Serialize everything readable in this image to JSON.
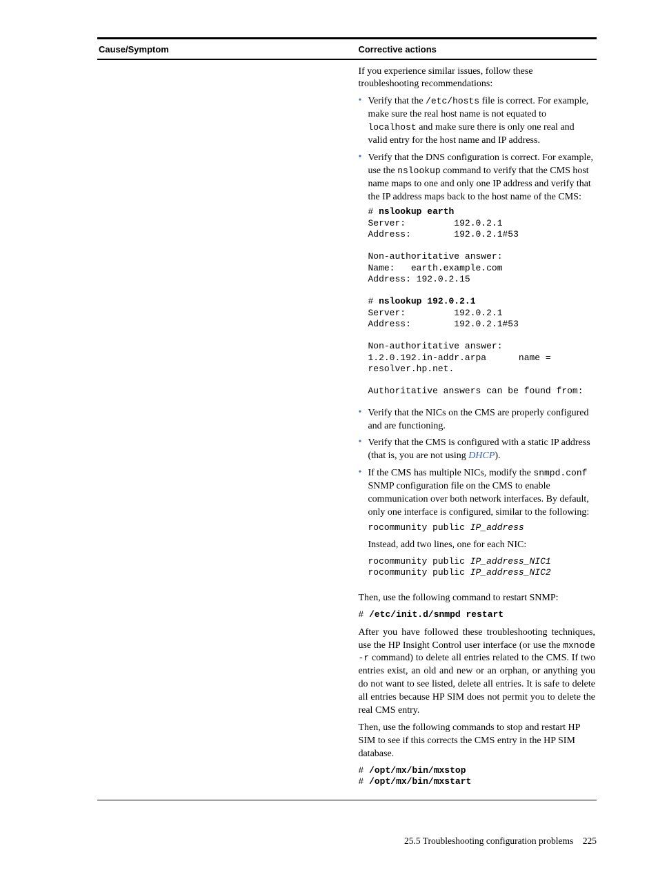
{
  "table_headers": {
    "left": "Cause/Symptom",
    "right": "Corrective actions"
  },
  "intro": {
    "lead": "If you experience similar issues, follow these troubleshooting recommendations:"
  },
  "bullets": {
    "b1_before": "Verify that the ",
    "b1_code1": "/etc/hosts",
    "b1_mid": " file is correct. For example, make sure the real host name is not equated to ",
    "b1_code2": "localhost",
    "b1_after": " and make sure there is only one real and valid entry for the host name and IP address.",
    "b2_before": "Verify that the DNS configuration is correct. For example, use the ",
    "b2_code1": "nslookup",
    "b2_after": " command to verify that the CMS host name maps to one and only one IP address and verify that the IP address maps back to the host name of the CMS:",
    "b3": "Verify that the NICs on the CMS are properly configured and are functioning.",
    "b4_before": "Verify that the CMS is configured with a static IP address (that is, you are not using ",
    "b4_link": "DHCP",
    "b4_after": ").",
    "b5_before": "If the CMS has multiple NICs, modify the ",
    "b5_code1": "snmpd.conf",
    "b5_after": " SNMP configuration file on the CMS to enable communication over both network interfaces. By default, only one interface is configured, similar to the following:",
    "b5_line_prefix": "rocommunity public ",
    "b5_line_ip": "IP_address",
    "b5_p2": "Instead, add two lines, one for each NIC:",
    "b5_line2_prefix": "rocommunity public ",
    "b5_line2_ip1": "IP_address_NIC1",
    "b5_line3_prefix": "rocommunity public ",
    "b5_line3_ip2": "IP_address_NIC2"
  },
  "console1": "# nslookup earth\nServer:         192.0.2.1\nAddress:        192.0.2.1#53\n\nNon-authoritative answer:\nName:   earth.example.com\nAddress: 192.0.2.15\n\n# nslookup 192.0.2.1\nServer:         192.0.2.1\nAddress:        192.0.2.1#53\n\nNon-authoritative answer:\n1.2.0.192.in-addr.arpa      name = \nresolver.hp.net.\n\nAuthoritative answers can be found from:",
  "console1_cmd1": "nslookup earth",
  "console1_cmd2": "nslookup 192.0.2.1",
  "after": {
    "p1": "Then, use the following command to restart SNMP:",
    "cmd1_hash": "# ",
    "cmd1_body": "/etc/init.d/snmpd restart",
    "p2_before": "After you have followed these troubleshooting techniques, use the HP Insight Control user interface (or use the ",
    "p2_code": "mxnode -r",
    "p2_after": " command) to delete all entries related to the CMS. If two entries exist, an old and new or an orphan, or anything you do not want to see listed, delete all entries. It is safe to delete all entries because HP SIM does not permit you to delete the real CMS entry.",
    "p3": "Then, use the following commands to stop and restart HP SIM to see if this corrects the CMS entry in the HP SIM database.",
    "cmd2_hash": "# ",
    "cmd2_body": "/opt/mx/bin/mxstop",
    "cmd3_hash": "# ",
    "cmd3_body": "/opt/mx/bin/mxstart"
  },
  "footer": {
    "section": "25.5 Troubleshooting configuration problems",
    "page": "225"
  }
}
